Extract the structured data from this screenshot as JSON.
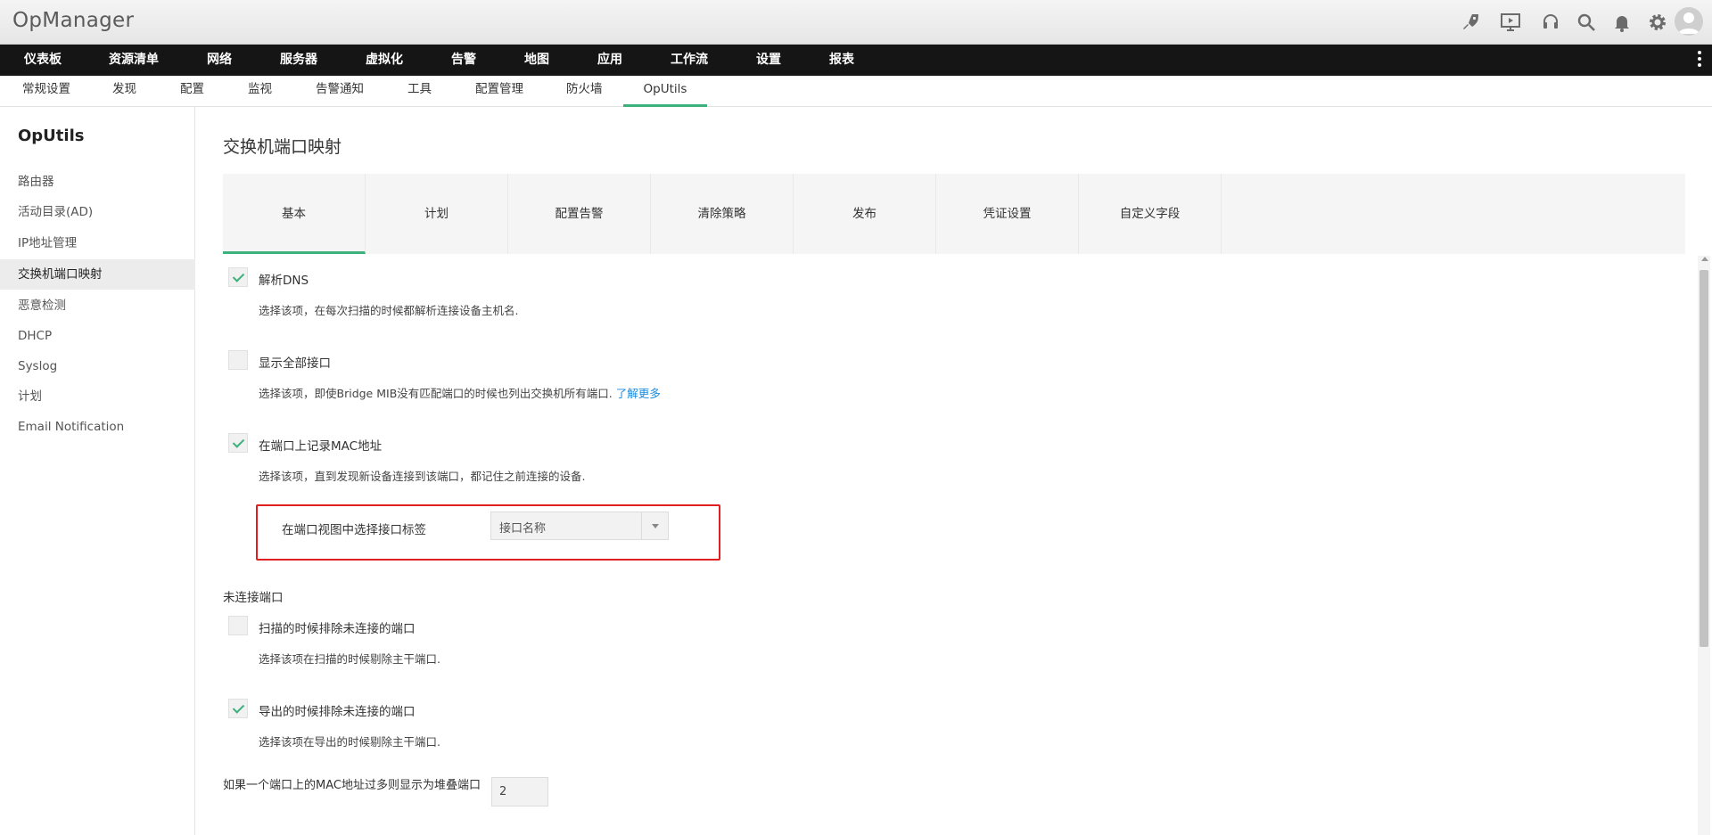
{
  "app": {
    "title": "OpManager"
  },
  "header_icons": [
    "rocket-icon",
    "presentation-icon",
    "headset-icon",
    "search-icon",
    "bell-icon",
    "gear-icon",
    "avatar"
  ],
  "main_nav": [
    "仪表板",
    "资源清单",
    "网络",
    "服务器",
    "虚拟化",
    "告警",
    "地图",
    "应用",
    "工作流",
    "设置",
    "报表"
  ],
  "sub_nav": [
    "常规设置",
    "发现",
    "配置",
    "监视",
    "告警通知",
    "工具",
    "配置管理",
    "防火墙",
    "OpUtils"
  ],
  "sub_nav_active": "OpUtils",
  "sidebar": {
    "title": "OpUtils",
    "items": [
      "路由器",
      "活动目录(AD)",
      "IP地址管理",
      "交换机端口映射",
      "恶意检测",
      "DHCP",
      "Syslog",
      "计划",
      "Email Notification"
    ],
    "active": "交换机端口映射"
  },
  "page": {
    "title": "交换机端口映射"
  },
  "tabs": [
    "基本",
    "计划",
    "配置告警",
    "清除策略",
    "发布",
    "凭证设置",
    "自定义字段"
  ],
  "tab_active": "基本",
  "options": [
    {
      "label": "解析DNS",
      "checked": true,
      "desc": "选择该项，在每次扫描的时候都解析连接设备主机名."
    },
    {
      "label": "显示全部接口",
      "checked": false,
      "desc": "选择该项，即使Bridge MIB没有匹配端口的时候也列出交换机所有端口.",
      "link": "了解更多"
    },
    {
      "label": "在端口上记录MAC地址",
      "checked": true,
      "desc": "选择该项，直到发现新设备连接到该端口，都记住之前连接的设备."
    }
  ],
  "port_label": {
    "label": "在端口视图中选择接口标签",
    "value": "接口名称"
  },
  "unconnected": {
    "title": "未连接端口",
    "options": [
      {
        "label": "扫描的时候排除未连接的端口",
        "checked": false,
        "desc": "选择该项在扫描的时候剔除主干端口."
      },
      {
        "label": "导出的时候排除未连接的端口",
        "checked": true,
        "desc": "选择该项在导出的时候剔除主干端口."
      }
    ]
  },
  "stacked": {
    "label": "如果一个端口上的MAC地址过多则显示为堆叠端口",
    "value": "2"
  },
  "colors": {
    "accent": "#3db07b",
    "link": "#1a8be0",
    "highlight": "#e02020",
    "nav_bg": "#151515"
  }
}
